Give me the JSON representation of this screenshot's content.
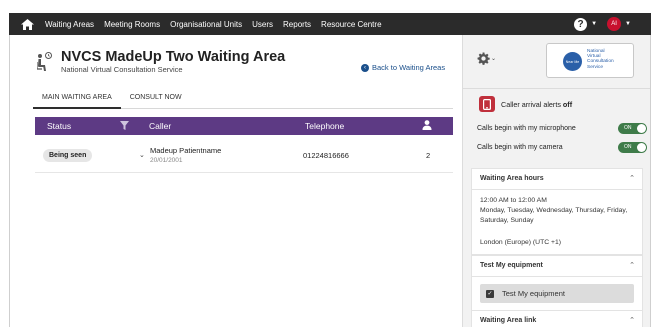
{
  "nav": {
    "items": [
      "Waiting Areas",
      "Meeting Rooms",
      "Organisational Units",
      "Users",
      "Reports",
      "Resource Centre"
    ],
    "help_symbol": "?",
    "avatar_initials": "AI"
  },
  "header": {
    "title": "NVCS MadeUp Two Waiting Area",
    "subtitle": "National Virtual Consultation Service",
    "back_link": "Back to Waiting Areas"
  },
  "tabs": [
    "MAIN WAITING AREA",
    "CONSULT NOW"
  ],
  "table": {
    "columns": {
      "status": "Status",
      "caller": "Caller",
      "telephone": "Telephone"
    },
    "rows": [
      {
        "status": "Being seen",
        "caller": "Madeup Patientname",
        "dob": "20/01/2001",
        "telephone": "01224816666",
        "count": "2"
      }
    ]
  },
  "panel": {
    "logo_lines": [
      "National",
      "Virtual",
      "Consultation",
      "Service"
    ],
    "logo_badge": "Near Me",
    "alerts_label": "Caller arrival alerts",
    "alerts_state": "off",
    "mic_label": "Calls begin with my microphone",
    "mic_state": "ON",
    "camera_label": "Calls begin with my camera",
    "camera_state": "ON",
    "hours_title": "Waiting Area hours",
    "hours_time": "12:00 AM to 12:00 AM",
    "hours_days": "Monday, Tuesday, Wednesday, Thursday, Friday, Saturday, Sunday",
    "hours_tz": "London (Europe) (UTC +1)",
    "equipment_title": "Test My equipment",
    "equipment_button": "Test My equipment",
    "link_title": "Waiting Area link"
  },
  "colors": {
    "nav_bg": "#2b2b2b",
    "table_header": "#5d3a84",
    "toggle_on": "#3f7c4a",
    "alert_red": "#c0303c",
    "link_blue": "#1a4f8b"
  }
}
